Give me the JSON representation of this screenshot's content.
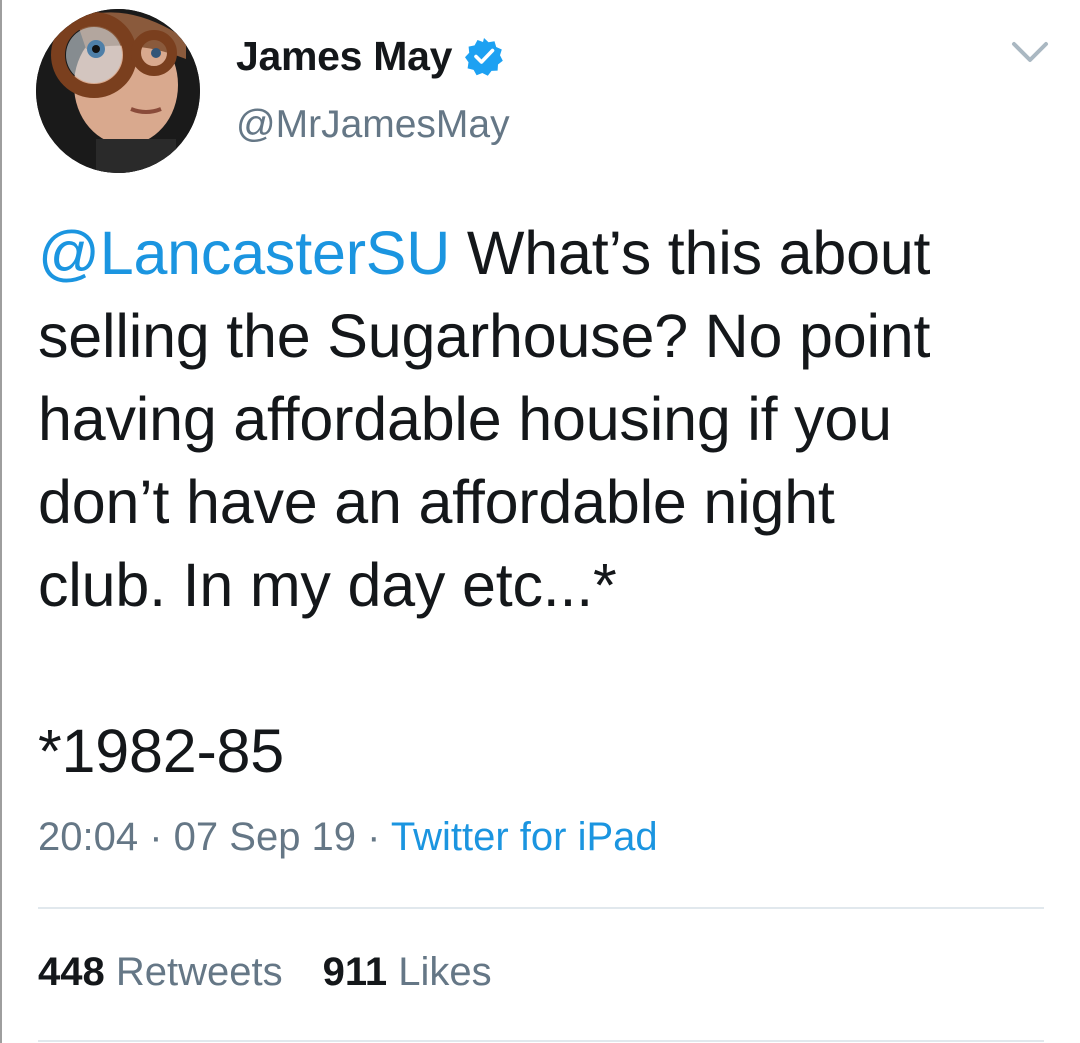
{
  "author": {
    "display_name": "James May",
    "handle": "@MrJamesMay",
    "verified": true
  },
  "tweet": {
    "mention": "@LancasterSU",
    "text": " What’s this about\nselling the Sugarhouse? No point\nhaving affordable housing if you\ndon’t have an affordable night\nclub. In my day etc...*\n\n*1982-85"
  },
  "meta": {
    "time": "20:04",
    "separator": " · ",
    "date": "07 Sep 19",
    "source": "Twitter for iPad"
  },
  "stats": {
    "retweets_count": "448",
    "retweets_label": "Retweets",
    "likes_count": "911",
    "likes_label": "Likes"
  },
  "colors": {
    "link": "#1b95e0",
    "secondary_text": "#657786",
    "primary_text": "#14171a"
  },
  "icons": {
    "verified": "verified-badge-icon",
    "more": "chevron-down-icon"
  }
}
